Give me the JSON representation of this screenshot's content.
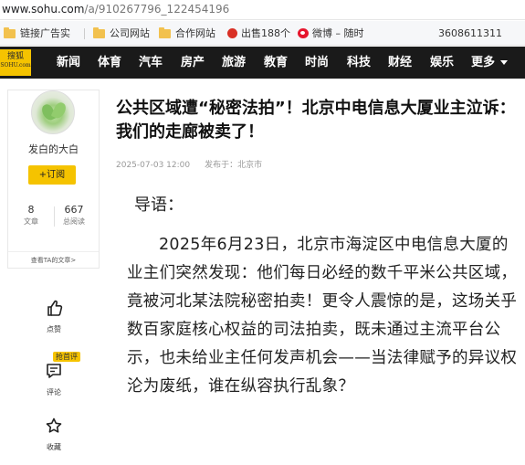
{
  "browser": {
    "url_host": "www.sohu.com",
    "url_path": "/a/910267796_122454196"
  },
  "bookmarks": [
    {
      "label": "链接广告实",
      "icon": "folder-icon"
    },
    {
      "label": "公司网站",
      "icon": "folder-icon"
    },
    {
      "label": "合作网站",
      "icon": "folder-icon"
    },
    {
      "label": "出售188个",
      "icon": "badge-icon"
    },
    {
      "label": "微博 – 随时",
      "icon": "weibo-icon"
    },
    {
      "label": "3608611311",
      "icon": ""
    }
  ],
  "logo": {
    "text": "搜狐",
    "subtext": "SOHU.com"
  },
  "nav": {
    "items": [
      "新闻",
      "体育",
      "汽车",
      "房产",
      "旅游",
      "教育",
      "时尚",
      "科技",
      "财经",
      "娱乐"
    ],
    "more": "更多"
  },
  "author": {
    "name": "发白的大白",
    "follow": "+订阅",
    "articles_count": "8",
    "articles_label": "文章",
    "reads_count": "667",
    "reads_label": "总阅读",
    "view_all": "查看TA的文章>"
  },
  "actions": {
    "like": "点赞",
    "comment_badge": "抢首评",
    "comment": "评论",
    "favorite": "收藏"
  },
  "article": {
    "title": "公共区域遭“秘密法拍”！北京中电信息大厦业主泣诉：我们的走廊被卖了！",
    "date": "2025-07-03 12:00",
    "published_in": "发布于：北京市",
    "lead": "导语：",
    "body": "2025年6月23日，北京市海淀区中电信息大厦的业主们突然发现：他们每日必经的数千平米公共区域，竟被河北某法院秘密拍卖！更令人震惊的是，这场关乎数百家庭核心权益的司法拍卖，既未通过主流平台公示，也未给业主任何发声机会——当法律赋予的异议权沦为废纸，谁在纵容执行乱象？"
  },
  "colors": {
    "nav_bg": "#1a1a1a",
    "brand_yellow": "#f5c300"
  }
}
